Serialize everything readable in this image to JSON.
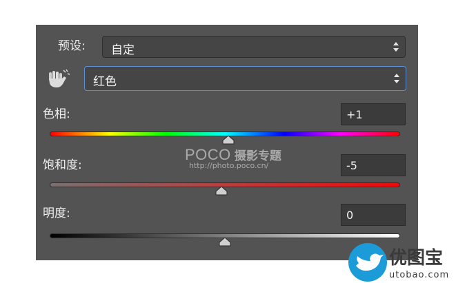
{
  "preset": {
    "label": "预设:",
    "value": "自定"
  },
  "channel": {
    "value": "红色"
  },
  "hue": {
    "label": "色相:",
    "value": "+1",
    "level": 0.51
  },
  "saturation": {
    "label": "饱和度:",
    "value": "-5",
    "level": 0.49
  },
  "lightness": {
    "label": "明度:",
    "value": "0",
    "level": 0.5
  },
  "watermark_poco": {
    "brand": "POCO",
    "title": "摄影专题",
    "url": "http://photo.poco.cn/"
  },
  "watermark_utobao": {
    "name": "优图宝",
    "domain": "utobao.com"
  },
  "colors": {
    "panel": "#535353",
    "accent_focus": "#5b8fd6"
  }
}
